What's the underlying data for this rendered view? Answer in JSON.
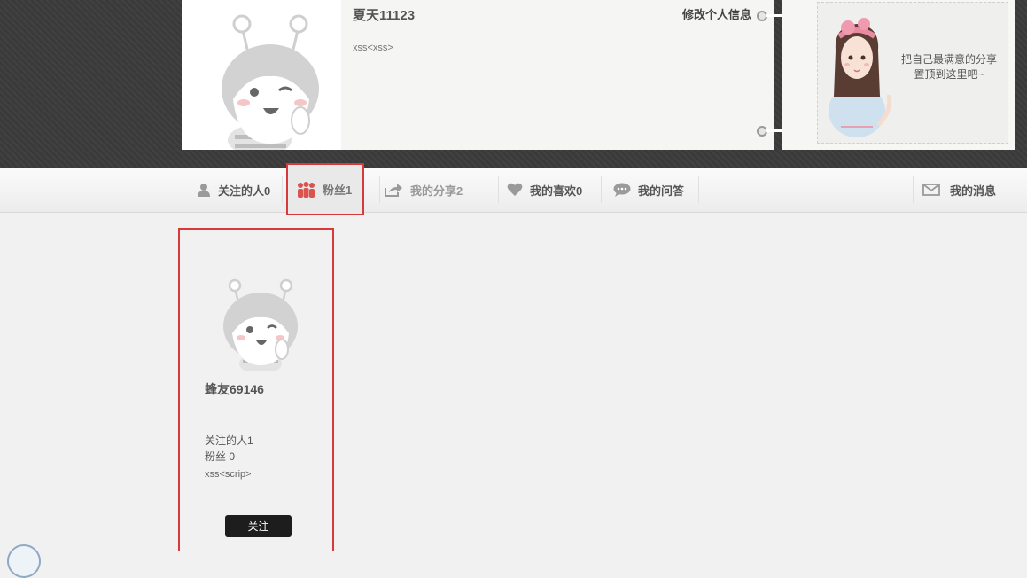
{
  "profile": {
    "name": "夏天11123",
    "bio": "xss<xss>",
    "edit_label": "修改个人信息"
  },
  "side_banner": {
    "text_line1": "把自己最满意的分享",
    "text_line2": "置顶到这里吧~"
  },
  "tabs": {
    "following": "关注的人0",
    "fans": "粉丝1",
    "shares": "我的分享2",
    "likes": "我的喜欢0",
    "qa": "我的问答",
    "messages": "我的消息"
  },
  "fan_card": {
    "name": "蜂友69146",
    "following": "关注的人1",
    "fans": "粉丝 0",
    "bio": "xss<scrip>",
    "follow_button": "关注"
  },
  "colors": {
    "highlight_border": "#d63a3a",
    "fans_icon": "#d9534f",
    "top_band": "#3a3a3a",
    "button_bg": "#1d1d1d"
  }
}
